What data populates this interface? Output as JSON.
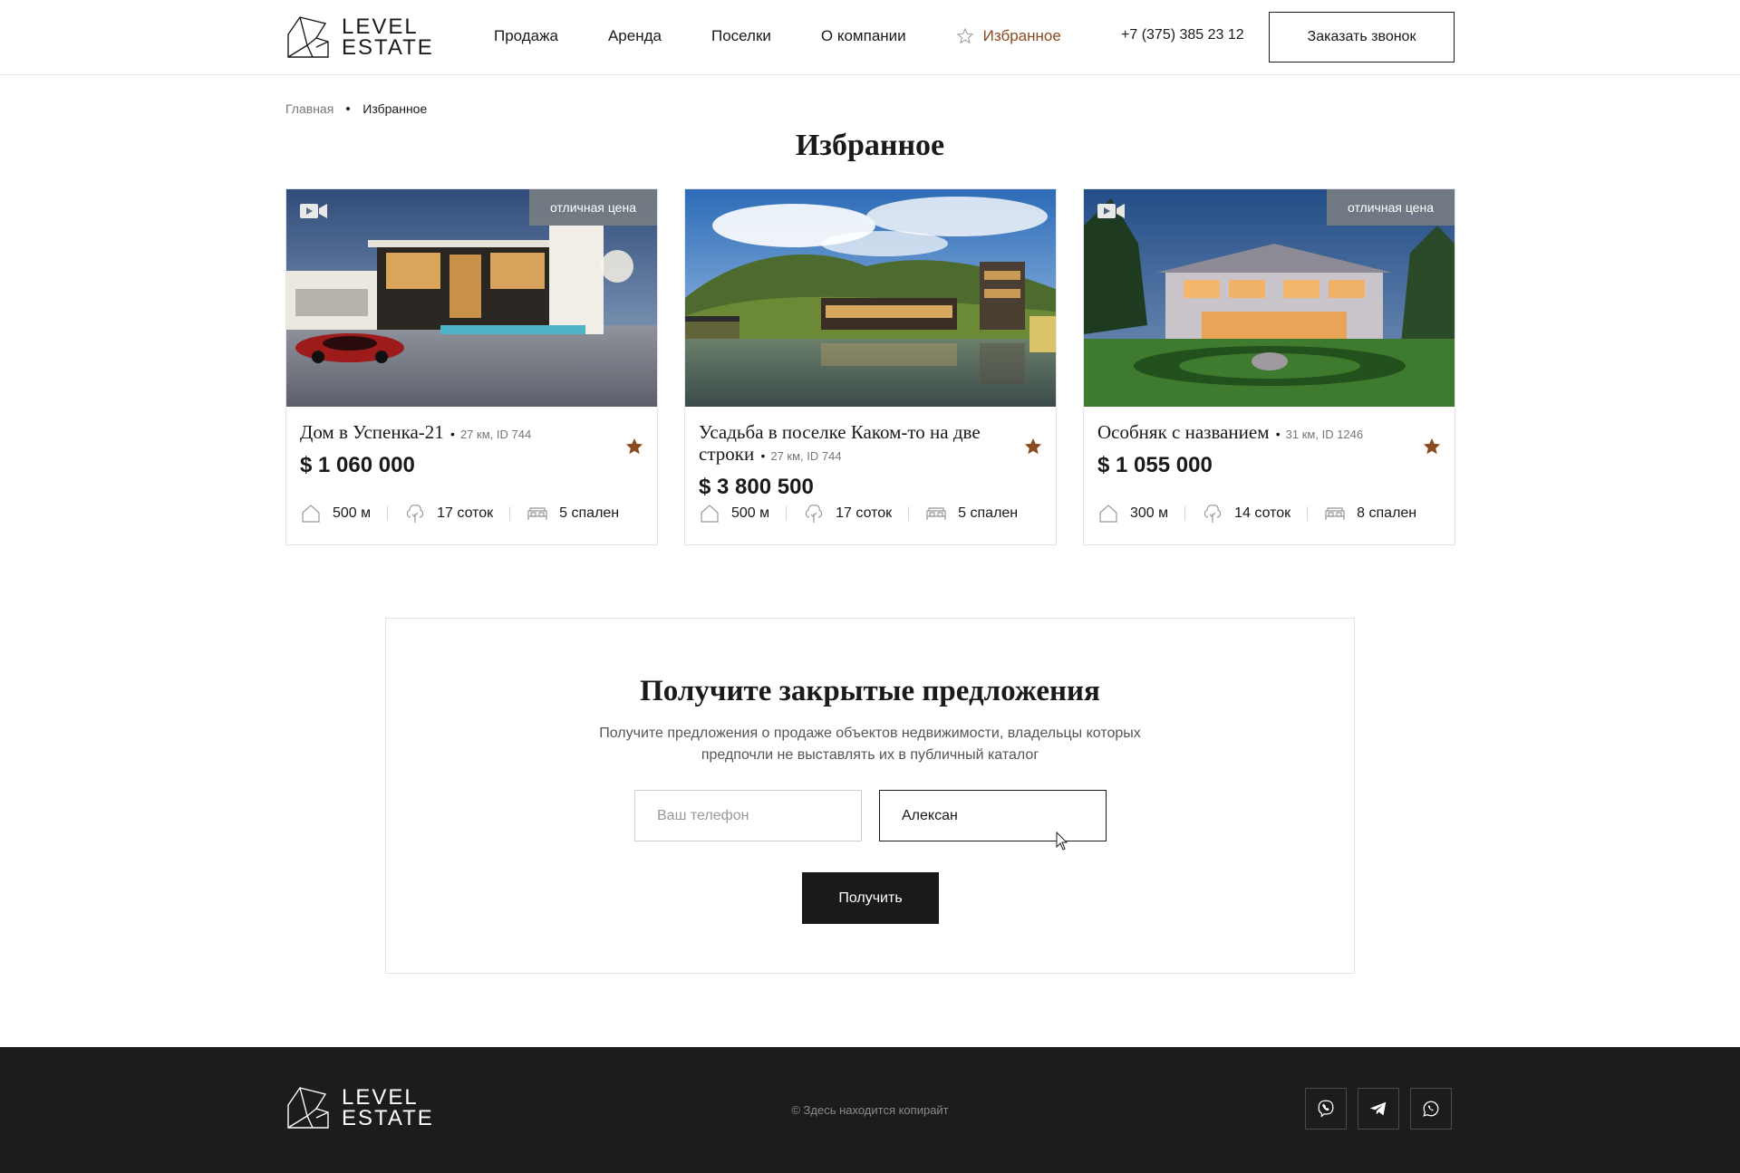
{
  "header": {
    "logo_line1": "LEVEL",
    "logo_line2": "ESTATE",
    "nav": [
      {
        "label": "Продажа"
      },
      {
        "label": "Аренда"
      },
      {
        "label": "Поселки"
      },
      {
        "label": "О компании"
      },
      {
        "label": "Избранное",
        "active": true
      }
    ],
    "phone": "+7 (375) 385 23 12",
    "call_button": "Заказать звонок"
  },
  "breadcrumb": {
    "home": "Главная",
    "current": "Избранное"
  },
  "page_title": "Избранное",
  "cards": [
    {
      "title": "Дом в Успенка-21",
      "meta": "27 км, ID 744",
      "price": "$ 1 060 000",
      "badge": "отличная цена",
      "has_video": true,
      "area": "500 м",
      "plot": "17 соток",
      "bedrooms": "5 спален",
      "favorite": true
    },
    {
      "title": "Усадьба в поселке Каком-то на две строки",
      "meta": "27 км, ID 744",
      "price": "$ 3 800 500",
      "badge": "",
      "has_video": false,
      "area": "500 м",
      "plot": "17 соток",
      "bedrooms": "5 спален",
      "favorite": true
    },
    {
      "title": "Особняк с названием",
      "meta": "31 км, ID 1246",
      "price": "$ 1 055 000",
      "badge": "отличная цена",
      "has_video": true,
      "area": "300 м",
      "plot": "14 соток",
      "bedrooms": "8 спален",
      "favorite": true
    }
  ],
  "offers": {
    "title": "Получите закрытые предложения",
    "text": "Получите предложения о продаже объектов недвижимости, владельцы которых предпочли не выставлять их в публичный каталог",
    "phone_placeholder": "Ваш телефон",
    "phone_value": "",
    "name_value": "Алексан",
    "submit": "Получить"
  },
  "footer": {
    "logo_line1": "LEVEL",
    "logo_line2": "ESTATE",
    "copyright": "© Здесь находится копирайт",
    "socials": [
      "viber-icon",
      "telegram-icon",
      "whatsapp-icon"
    ]
  },
  "colors": {
    "accent": "#8b4a1f",
    "dark": "#1a1a1a",
    "footer_bg": "#1c1c1c",
    "badge_bg": "#787d82"
  }
}
